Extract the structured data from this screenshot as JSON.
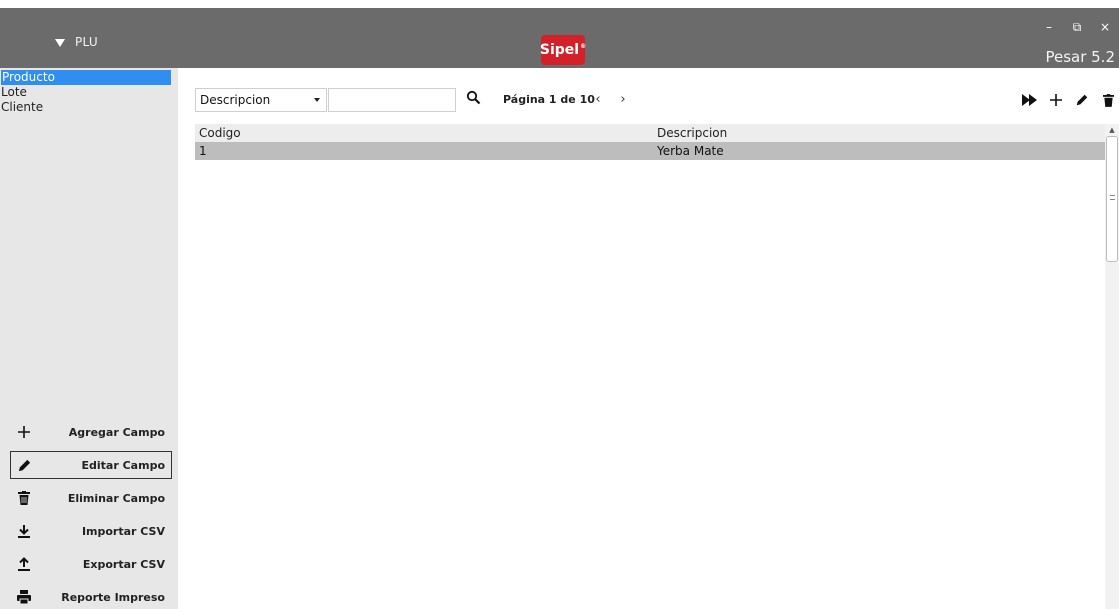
{
  "header": {
    "menu_label": "PLU",
    "logo_text": "Sipel",
    "logo_mark": "®",
    "version": "Pesar 5.2",
    "window_controls": {
      "minimize": "–",
      "restore": "⧉",
      "close": "×"
    }
  },
  "sidebar": {
    "items": [
      {
        "label": "Producto",
        "active": true
      },
      {
        "label": "Lote"
      },
      {
        "label": "Cliente"
      }
    ],
    "actions": [
      {
        "label": "Agregar Campo",
        "icon": "plus-icon"
      },
      {
        "label": "Editar Campo",
        "icon": "pencil-icon"
      },
      {
        "label": "Eliminar Campo",
        "icon": "trash-icon"
      },
      {
        "label": "Importar CSV",
        "icon": "download-icon"
      },
      {
        "label": "Exportar CSV",
        "icon": "upload-icon"
      },
      {
        "label": "Reporte Impreso",
        "icon": "printer-icon"
      }
    ]
  },
  "toolbar": {
    "field_select": "Descripcion",
    "search_value": "",
    "pagination": "Página 1 de 10",
    "prev": "‹",
    "next": "›"
  },
  "table": {
    "columns": [
      "Codigo",
      "Descripcion"
    ],
    "rows": [
      [
        "1",
        "Yerba Mate"
      ]
    ]
  },
  "colors": {
    "topbar": "#6b6b6b",
    "sidebar": "#e7e7e7",
    "active_item": "#2f8ef0",
    "logo": "#d3212a",
    "selected_row": "#bdbdbd"
  }
}
